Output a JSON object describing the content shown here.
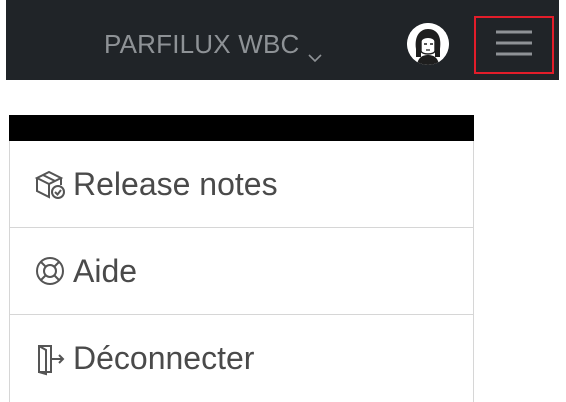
{
  "topbar": {
    "brand_label": "PARFILUX WBC",
    "brand_icon": "chevron-down-icon",
    "avatar_icon": "user-avatar",
    "menu_icon": "hamburger-menu-icon",
    "menu_highlight_color": "#e21d2a",
    "background_color": "#202428"
  },
  "menu": {
    "items": [
      {
        "label": "Release notes",
        "icon": "package-check-icon"
      },
      {
        "label": "Aide",
        "icon": "lifebuoy-icon"
      },
      {
        "label": "Déconnecter",
        "icon": "logout-door-icon"
      }
    ]
  }
}
